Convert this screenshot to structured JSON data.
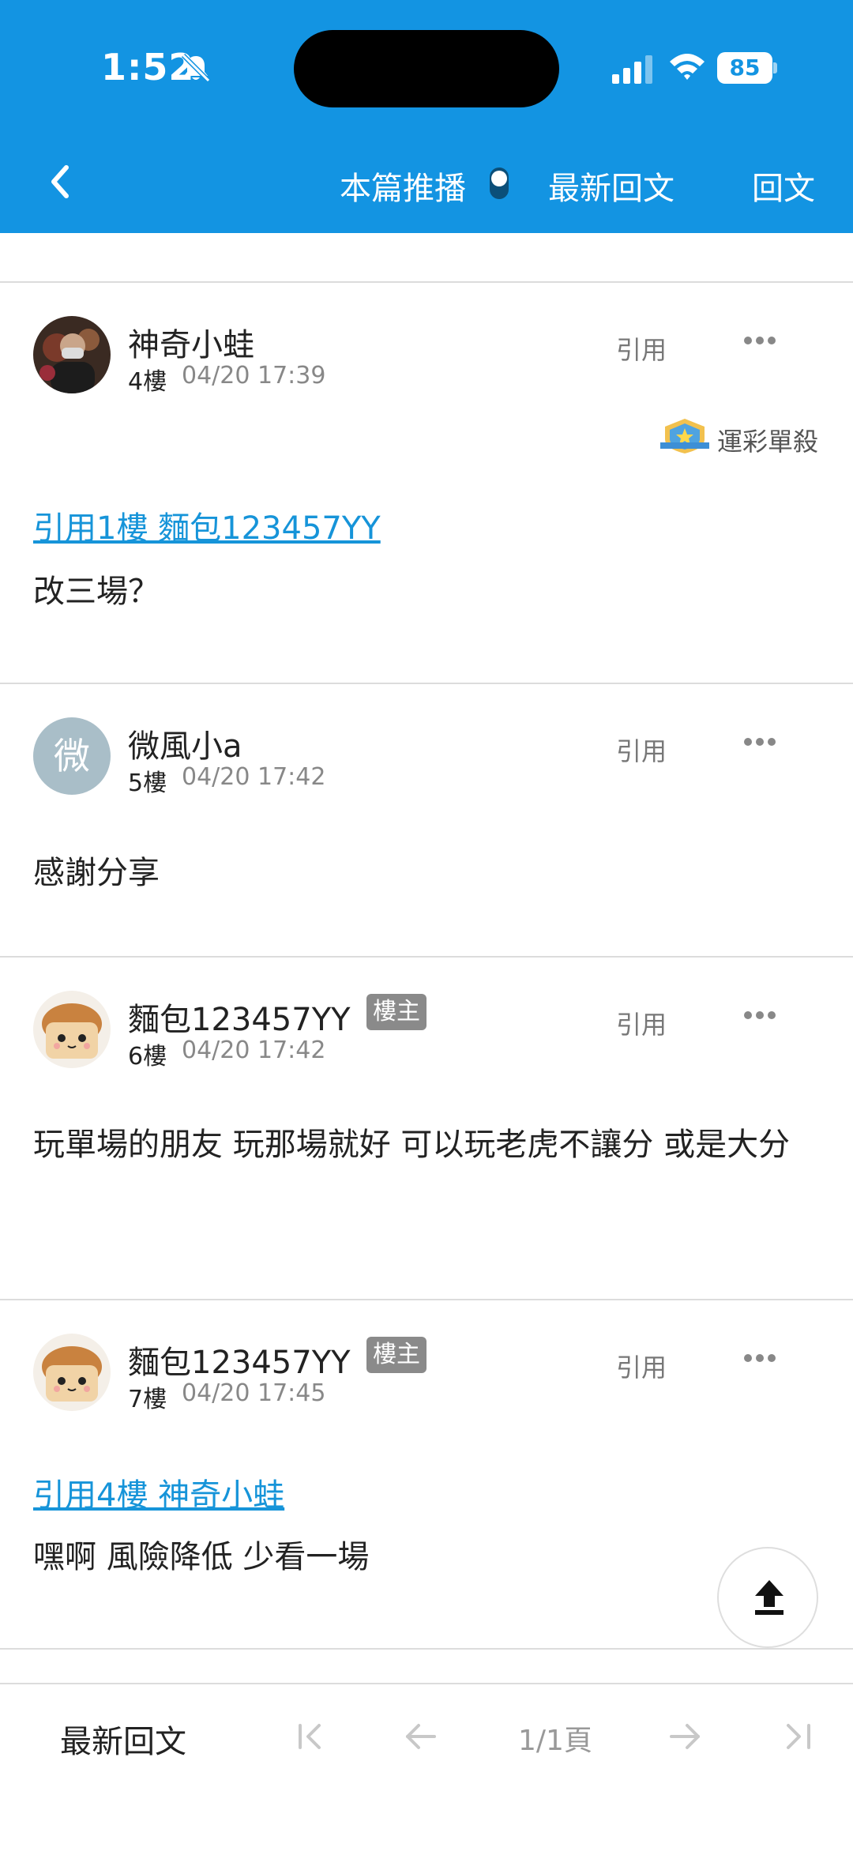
{
  "status_bar": {
    "time": "1:52",
    "battery": "85"
  },
  "nav": {
    "push_label": "本篇推播",
    "latest_label": "最新回文",
    "reply_label": "回文"
  },
  "posts": [
    {
      "username": "神奇小蛙",
      "floor": "4樓",
      "time": "04/20 17:39",
      "quote_btn": "引用",
      "medal": "運彩單殺",
      "quote_link": "引用1樓 麵包123457YY",
      "content": "改三場？"
    },
    {
      "username": "微風小a",
      "avatar_letter": "微",
      "floor": "5樓",
      "time": "04/20 17:42",
      "quote_btn": "引用",
      "content": "感謝分享"
    },
    {
      "username": "麵包123457YY",
      "badge": "樓主",
      "floor": "6樓",
      "time": "04/20 17:42",
      "quote_btn": "引用",
      "content": "玩單場的朋友 玩那場就好 可以玩老虎不讓分 或是大分"
    },
    {
      "username": "麵包123457YY",
      "badge": "樓主",
      "floor": "7樓",
      "time": "04/20 17:45",
      "quote_btn": "引用",
      "quote_link": "引用4樓 神奇小蛙",
      "content": "嘿啊 風險降低 少看一場"
    }
  ],
  "bottom_bar": {
    "latest_label": "最新回文",
    "page_indicator": "1/1頁"
  },
  "colors": {
    "header": "#1394e2",
    "link": "#1694d9",
    "badge": "#8a8a8a"
  }
}
